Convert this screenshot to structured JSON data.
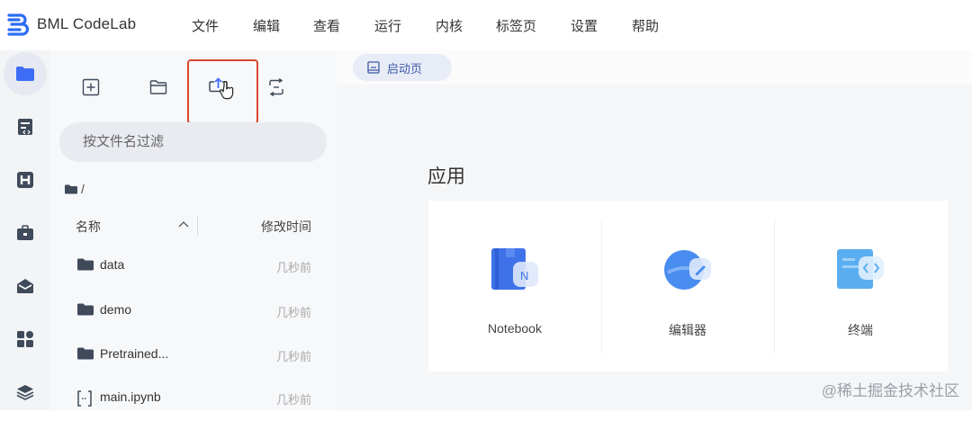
{
  "app": {
    "title": "BML CodeLab"
  },
  "menu": [
    {
      "label": "文件"
    },
    {
      "label": "编辑"
    },
    {
      "label": "查看"
    },
    {
      "label": "运行"
    },
    {
      "label": "内核"
    },
    {
      "label": "标签页"
    },
    {
      "label": "设置"
    },
    {
      "label": "帮助"
    }
  ],
  "activity_bar": [
    {
      "icon": "folder-icon",
      "active": true
    },
    {
      "icon": "notebook-icon"
    },
    {
      "icon": "hub-icon"
    },
    {
      "icon": "toolbox-icon"
    },
    {
      "icon": "mail-icon"
    },
    {
      "icon": "extensions-icon"
    },
    {
      "icon": "layers-icon"
    }
  ],
  "file_browser": {
    "toolbar": [
      "new-file-icon",
      "new-folder-icon",
      "upload-icon",
      "refresh-icon"
    ],
    "filter_placeholder": "按文件名过滤",
    "breadcrumb": "/",
    "columns": {
      "name": "名称",
      "modified": "修改时间"
    },
    "files": [
      {
        "type": "folder",
        "name": "data",
        "modified": "几秒前"
      },
      {
        "type": "folder",
        "name": "demo",
        "modified": "几秒前"
      },
      {
        "type": "folder",
        "name": "Pretrained...",
        "modified": "几秒前"
      },
      {
        "type": "notebook",
        "name": "main.ipynb",
        "modified": "几秒前"
      }
    ]
  },
  "main": {
    "tab_label": "启动页",
    "section_title": "应用",
    "apps": [
      {
        "label": "Notebook",
        "icon": "notebook-app-icon"
      },
      {
        "label": "编辑器",
        "icon": "editor-app-icon"
      },
      {
        "label": "终端",
        "icon": "terminal-app-icon"
      }
    ]
  },
  "watermark": "@稀土掘金技术社区",
  "colors": {
    "accent": "#3d6ef5",
    "highlight": "#d9472c"
  }
}
